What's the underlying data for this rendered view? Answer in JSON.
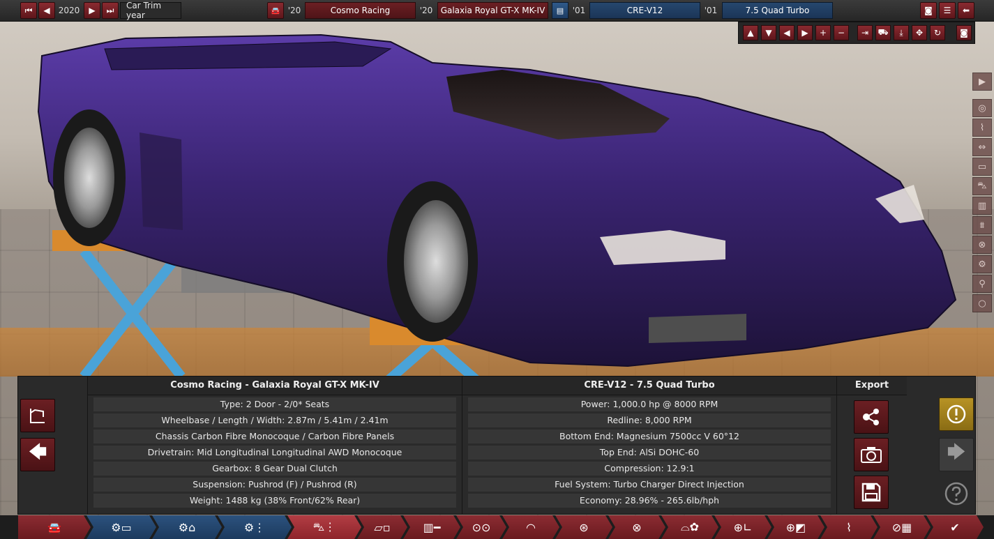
{
  "topbar": {
    "trim_year": "2020",
    "trim_year_label": "Car Trim year",
    "model_year": "'20",
    "company": "Cosmo Racing",
    "trim_year_short": "'20",
    "car_name": "Galaxia Royal GT-X MK-IV",
    "engine_year": "'01",
    "engine_family": "CRE-V12",
    "variant_year": "'01",
    "engine_variant": "7.5 Quad Turbo"
  },
  "panel": {
    "car_header": "Cosmo Racing - Galaxia Royal GT-X MK-IV",
    "engine_header": "CRE-V12 - 7.5 Quad Turbo",
    "export_header": "Export",
    "car_specs": [
      "Type: 2 Door - 2/0* Seats",
      "Wheelbase / Length / Width: 2.87m / 5.41m / 2.41m",
      "Chassis Carbon Fibre Monocoque / Carbon Fibre Panels",
      "Drivetrain: Mid Longitudinal Longitudinal AWD Monocoque",
      "Gearbox: 8 Gear Dual Clutch",
      "Suspension: Pushrod (F) / Pushrod (R)",
      "Weight: 1488 kg (38% Front/62% Rear)"
    ],
    "engine_specs": [
      "Power: 1,000.0 hp @ 8000 RPM",
      "Redline:  8,000 RPM",
      "Bottom End: Magnesium 7500cc V 60°12",
      "Top End: AlSi DOHC-60",
      "Compression: 12.9:1",
      "Fuel System: Turbo Charger Direct Injection",
      "Economy: 28.96% - 265.6lb/hph"
    ]
  },
  "icons": {
    "first": "skip-back-icon",
    "prev": "prev-icon",
    "next": "next-icon",
    "last": "skip-forward-icon",
    "camera": "camera-icon",
    "menu": "menu-icon",
    "back": "back-icon"
  },
  "colors": {
    "accent_red": "#8a2a30",
    "accent_blue": "#26476e",
    "selected_tab": "#b23d44",
    "warning": "#b89325"
  }
}
